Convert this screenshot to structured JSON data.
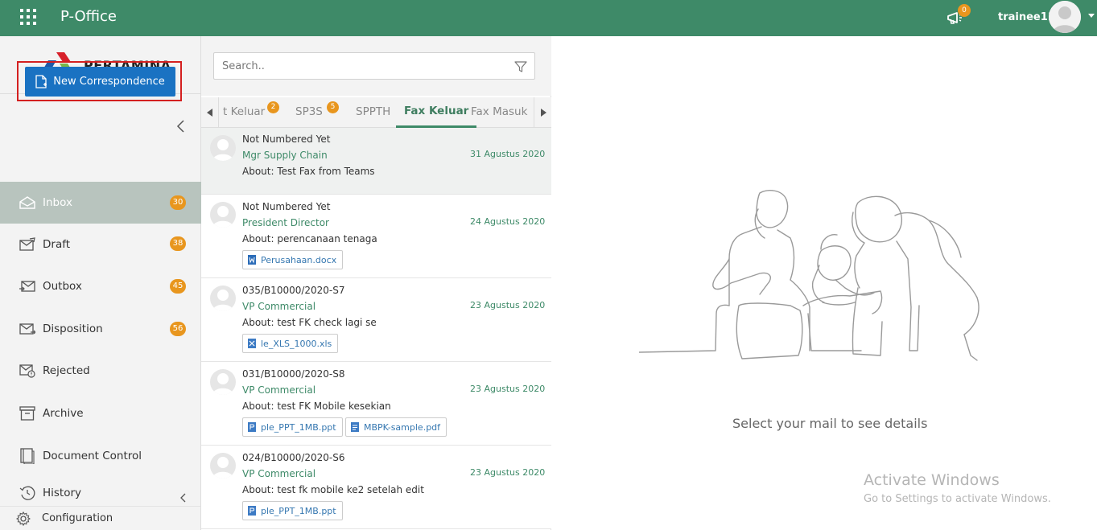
{
  "header": {
    "app_title": "P-Office",
    "notification_count": "0",
    "username": "trainee11"
  },
  "sidebar": {
    "logo_text": "PERTAMINA",
    "new_correspondence_label": "New Correspondence",
    "items": [
      {
        "label": "Inbox",
        "badge": "30",
        "icon": "inbox-icon",
        "active": true
      },
      {
        "label": "Draft",
        "badge": "38",
        "icon": "draft-icon"
      },
      {
        "label": "Outbox",
        "badge": "45",
        "icon": "outbox-icon"
      },
      {
        "label": "Disposition",
        "badge": "56",
        "icon": "disposition-icon"
      },
      {
        "label": "Rejected",
        "badge": "",
        "icon": "rejected-icon"
      },
      {
        "label": "Archive",
        "badge": "",
        "icon": "archive-icon"
      },
      {
        "label": "Document Control",
        "badge": "",
        "icon": "document-control-icon"
      },
      {
        "label": "History",
        "badge": "",
        "icon": "history-icon"
      }
    ],
    "configuration_label": "Configuration"
  },
  "search": {
    "placeholder": "Search.."
  },
  "tabs": [
    {
      "label": "t Keluar",
      "badge": "2"
    },
    {
      "label": "SP3S",
      "badge": "5"
    },
    {
      "label": "SPPTH",
      "badge": ""
    },
    {
      "label": "Fax Keluar",
      "badge": "",
      "active": true
    },
    {
      "label": "Fax Masuk",
      "badge": ""
    }
  ],
  "mails": [
    {
      "number": "Not Numbered Yet",
      "sender": "Mgr Supply Chain",
      "date": "31 Agustus 2020",
      "about": "About: Test Fax from Teams",
      "attachments": []
    },
    {
      "number": "Not Numbered Yet",
      "sender": "President Director",
      "date": "24 Agustus 2020",
      "about": "About: perencanaan tenaga",
      "attachments": [
        {
          "name": "Perusahaan.docx",
          "type": "word"
        }
      ]
    },
    {
      "number": "035/B10000/2020-S7",
      "sender": "VP Commercial",
      "date": "23 Agustus 2020",
      "about": "About: test FK check lagi se",
      "attachments": [
        {
          "name": "le_XLS_1000.xls",
          "type": "excel"
        }
      ]
    },
    {
      "number": "031/B10000/2020-S8",
      "sender": "VP Commercial",
      "date": "23 Agustus 2020",
      "about": "About: test FK Mobile kesekian",
      "attachments": [
        {
          "name": "ple_PPT_1MB.ppt",
          "type": "ppt"
        },
        {
          "name": "MBPK-sample.pdf",
          "type": "pdf"
        }
      ]
    },
    {
      "number": "024/B10000/2020-S6",
      "sender": "VP Commercial",
      "date": "23 Agustus 2020",
      "about": "About: test fk mobile ke2 setelah edit",
      "attachments": [
        {
          "name": "ple_PPT_1MB.ppt",
          "type": "ppt"
        }
      ]
    }
  ],
  "detail": {
    "empty_message": "Select your mail to see details"
  },
  "watermark": {
    "title": "Activate Windows",
    "subtitle": "Go to Settings to activate Windows."
  },
  "colors": {
    "header_green": "#3e8a68",
    "accent_blue": "#1a72c2",
    "badge_orange": "#e8961e",
    "highlight_red": "#d42020"
  }
}
